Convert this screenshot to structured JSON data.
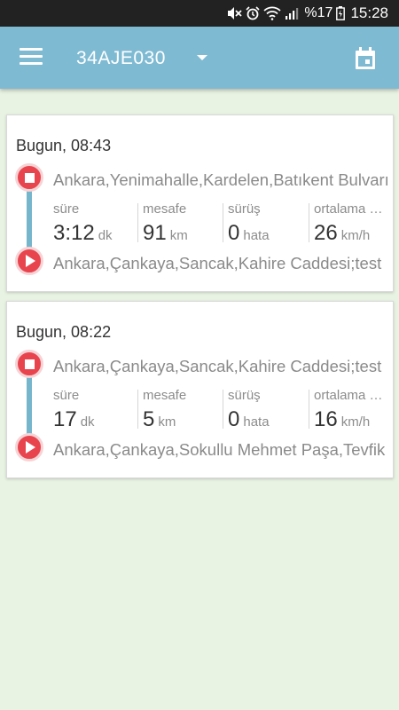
{
  "status_bar": {
    "battery_percent": "%17",
    "time": "15:28",
    "icons": [
      "mute-icon",
      "alarm-icon",
      "wifi-icon",
      "signal-icon",
      "battery-icon"
    ]
  },
  "app_bar": {
    "vehicle_plate": "34AJE030",
    "icons": [
      "menu-icon",
      "dropdown-caret-icon",
      "calendar-icon"
    ]
  },
  "trips": [
    {
      "date": "Bugun, 08:43",
      "end_address": "Ankara,Yenimahalle,Kardelen,Batıkent Bulvarı",
      "start_address": "Ankara,Çankaya,Sancak,Kahire Caddesi;test",
      "stats": [
        {
          "label": "süre",
          "value": "3:12",
          "unit": "dk"
        },
        {
          "label": "mesafe",
          "value": "91",
          "unit": "km"
        },
        {
          "label": "sürüş",
          "value": "0",
          "unit": "hata"
        },
        {
          "label": "ortalama hız",
          "value": "26",
          "unit": "km/h"
        }
      ]
    },
    {
      "date": "Bugun, 08:22",
      "end_address": "Ankara,Çankaya,Sancak,Kahire Caddesi;test",
      "start_address": "Ankara,Çankaya,Sokullu Mehmet Paşa,Tevfik",
      "stats": [
        {
          "label": "süre",
          "value": "17",
          "unit": "dk"
        },
        {
          "label": "mesafe",
          "value": "5",
          "unit": "km"
        },
        {
          "label": "sürüş",
          "value": "0",
          "unit": "hata"
        },
        {
          "label": "ortalama hız",
          "value": "16",
          "unit": "km/h"
        }
      ]
    }
  ],
  "colors": {
    "app_bar": "#7fbad3",
    "background": "#e9f3e3",
    "marker_red": "#e8444e",
    "timeline": "#76b6cc"
  }
}
